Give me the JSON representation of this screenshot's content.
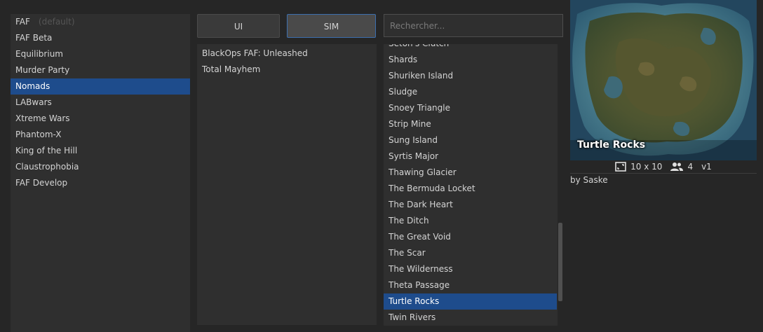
{
  "featured_mods": [
    {
      "label": "FAF",
      "tag": "(default)"
    },
    {
      "label": "FAF Beta"
    },
    {
      "label": "Equilibrium"
    },
    {
      "label": "Murder Party"
    },
    {
      "label": "Nomads",
      "selected": true
    },
    {
      "label": "LABwars"
    },
    {
      "label": "Xtreme Wars"
    },
    {
      "label": "Phantom-X"
    },
    {
      "label": "King of the Hill"
    },
    {
      "label": "Claustrophobia"
    },
    {
      "label": "FAF Develop"
    }
  ],
  "mod_tabs": {
    "ui_label": "UI",
    "sim_label": "SIM",
    "active": "SIM"
  },
  "search": {
    "placeholder": "Rechercher...",
    "value": ""
  },
  "mods": [
    {
      "label": "BlackOps FAF: Unleashed"
    },
    {
      "label": "Total Mayhem"
    }
  ],
  "maps": [
    {
      "label": "Seton's Clutch"
    },
    {
      "label": "Shards"
    },
    {
      "label": "Shuriken Island"
    },
    {
      "label": "Sludge"
    },
    {
      "label": "Snoey Triangle"
    },
    {
      "label": "Strip Mine"
    },
    {
      "label": "Sung Island"
    },
    {
      "label": "Syrtis Major"
    },
    {
      "label": "Thawing Glacier"
    },
    {
      "label": "The Bermuda Locket"
    },
    {
      "label": "The Dark Heart"
    },
    {
      "label": "The Ditch"
    },
    {
      "label": "The Great Void"
    },
    {
      "label": "The Scar"
    },
    {
      "label": "The Wilderness"
    },
    {
      "label": "Theta Passage"
    },
    {
      "label": "Turtle Rocks",
      "selected": true
    },
    {
      "label": "Twin Rivers"
    }
  ],
  "map_details": {
    "name": "Turtle Rocks",
    "size": "10 x 10",
    "players": "4",
    "version": "v1",
    "author": "by Saske",
    "size_icon": "map-size-icon",
    "players_icon": "players-icon"
  },
  "colors": {
    "selection": "#1e4c8c",
    "accent_border": "#3c6fae"
  }
}
